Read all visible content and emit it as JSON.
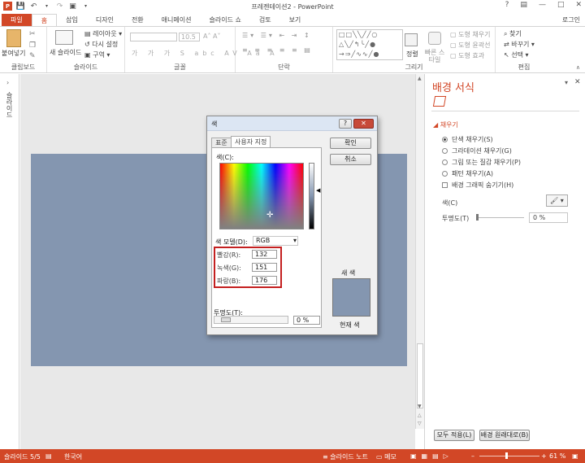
{
  "window": {
    "title": "프레젠테이션2 - PowerPoint",
    "login": "로그인"
  },
  "tabs": [
    "파일",
    "홈",
    "삽입",
    "디자인",
    "전환",
    "애니메이션",
    "슬라이드 쇼",
    "검토",
    "보기"
  ],
  "ribbon": {
    "clipboard": {
      "label": "클립보드",
      "paste": "붙여넣기"
    },
    "slides": {
      "label": "슬라이드",
      "new_slide": "새 슬라이드",
      "layout": "레이아웃",
      "reset": "다시 설정",
      "section": "구역"
    },
    "font": {
      "label": "글꼴",
      "size": "10.5"
    },
    "paragraph": {
      "label": "단락"
    },
    "drawing": {
      "label": "그리기",
      "arrange": "정렬",
      "quick_styles": "빠른 스타일",
      "fill": "도형 채우기",
      "outline": "도형 윤곽선",
      "effects": "도형 효과"
    },
    "editing": {
      "label": "편집",
      "find": "찾기",
      "replace": "바꾸기",
      "select": "선택"
    }
  },
  "left_strip": {
    "label": "슬라이드"
  },
  "pane": {
    "title": "배경 서식",
    "section": "채우기",
    "options": [
      {
        "label": "단색 채우기(S)",
        "selected": true
      },
      {
        "label": "그라데이션 채우기(G)",
        "selected": false
      },
      {
        "label": "그림 또는 질감 채우기(P)",
        "selected": false
      },
      {
        "label": "패턴 채우기(A)",
        "selected": false
      }
    ],
    "hide_bg": "배경 그래픽 숨기기(H)",
    "color_label": "색(C)",
    "transparency_label": "투명도(T)",
    "transparency_value": "0 %",
    "apply_all": "모두 적용(L)",
    "reset_bg": "배경 원래대로(B)"
  },
  "dialog": {
    "title": "색",
    "help": "?",
    "tab_standard": "표준",
    "tab_custom": "사용자 지정",
    "colors_label": "색(C):",
    "model_label": "색 모델(D):",
    "model_value": "RGB",
    "ok": "확인",
    "cancel": "취소",
    "red_label": "빨강(R):",
    "red": "132",
    "green_label": "녹색(G):",
    "green": "151",
    "blue_label": "파랑(B):",
    "blue": "176",
    "transparency_label": "투명도(T):",
    "transparency_value": "0 %",
    "new_label": "새 색",
    "current_label": "현재 색"
  },
  "status": {
    "slide": "슬라이드 5/5",
    "lang": "한국어",
    "notes": "슬라이드 노트",
    "memo": "메모",
    "zoom": "61 %"
  },
  "colors": {
    "accent": "#d24726",
    "background": "#8496b0",
    "highlight_box": "#c42020"
  }
}
